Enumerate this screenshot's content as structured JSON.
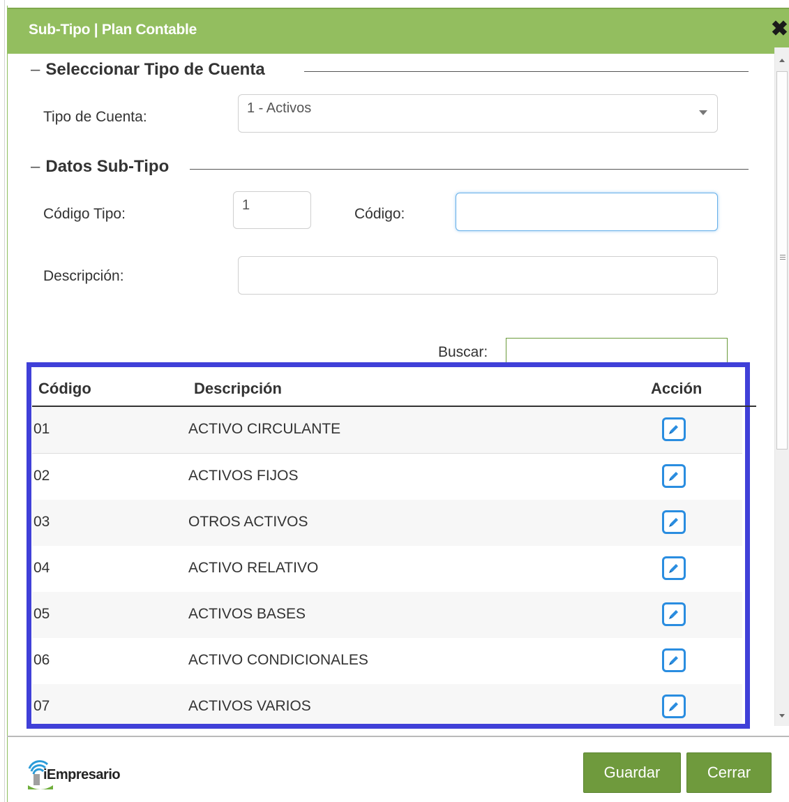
{
  "dialog": {
    "title": "Sub-Tipo | Plan Contable",
    "close_glyph": "✖"
  },
  "section_tipo": {
    "legend": "Seleccionar Tipo de Cuenta",
    "tipo_label": "Tipo de Cuenta:",
    "tipo_value": "1 - Activos"
  },
  "section_datos": {
    "legend": "Datos Sub-Tipo",
    "codigo_tipo_label": "Código Tipo:",
    "codigo_tipo_value": "1",
    "codigo_label": "Código:",
    "codigo_value": "",
    "descripcion_label": "Descripción:",
    "descripcion_value": ""
  },
  "search": {
    "label": "Buscar:",
    "value": ""
  },
  "table": {
    "columns": [
      "Código",
      "Descripción",
      "Acción"
    ],
    "rows": [
      {
        "codigo": "01",
        "descripcion": "ACTIVO CIRCULANTE"
      },
      {
        "codigo": "02",
        "descripcion": "ACTIVOS FIJOS"
      },
      {
        "codigo": "03",
        "descripcion": "OTROS ACTIVOS"
      },
      {
        "codigo": "04",
        "descripcion": "ACTIVO RELATIVO"
      },
      {
        "codigo": "05",
        "descripcion": "ACTIVOS BASES"
      },
      {
        "codigo": "06",
        "descripcion": "ACTIVO CONDICIONALES"
      },
      {
        "codigo": "07",
        "descripcion": "ACTIVOS VARIOS"
      }
    ],
    "action_icon": "pencil-edit-icon"
  },
  "footer": {
    "logo_text": "iEmpresario",
    "save_label": "Guardar",
    "close_label": "Cerrar"
  },
  "colors": {
    "titlebar": "#93be5f",
    "button": "#6f9a3d",
    "highlight": "#4040d8",
    "edit_icon": "#2a8de0"
  }
}
